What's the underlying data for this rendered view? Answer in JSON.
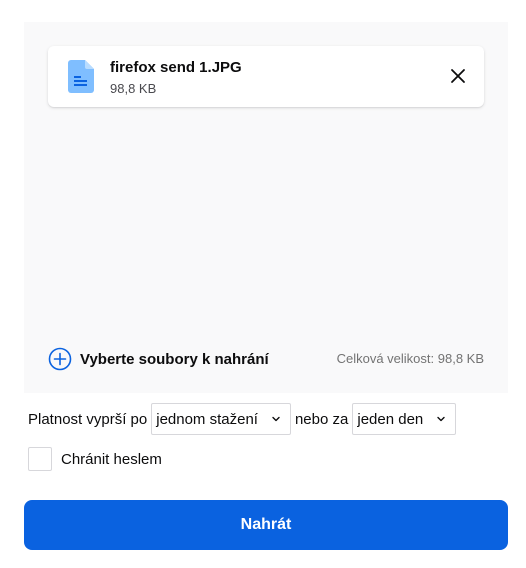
{
  "file_card": {
    "name": "firefox send 1.JPG",
    "size": "98,8 KB"
  },
  "add_files": {
    "label": "Vyberte soubory k nahrání"
  },
  "total_size": "Celková velikost: 98,8 KB",
  "expiry": {
    "prefix": "Platnost vyprší po",
    "downloads_selected": "jednom stažení",
    "middle": "nebo za",
    "time_selected": "jeden den"
  },
  "password": {
    "label": "Chránit heslem",
    "checked": false
  },
  "upload_button": {
    "label": "Nahrát"
  },
  "colors": {
    "accent": "#0a62e0",
    "file_icon": "#7fbeff",
    "area_bg": "#f9f9fa"
  }
}
